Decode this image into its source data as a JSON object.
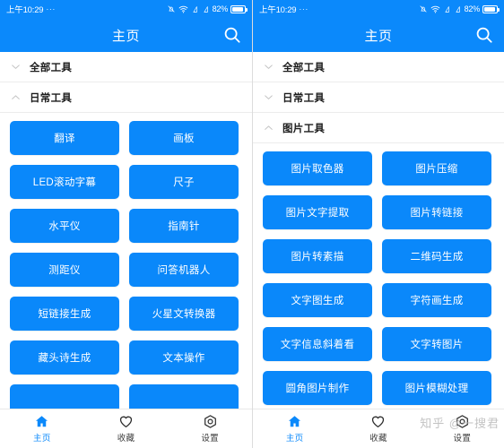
{
  "theme": {
    "primary": "#0b89fb",
    "button": "#0a88fa",
    "button_text": "#ffffff",
    "divider": "#ececec",
    "text": "#1b1b1b",
    "tab_inactive": "#3c3c3c",
    "watermark_color": "#b9b9b9"
  },
  "status_bar": {
    "time": "上午10:29",
    "dots": "···",
    "battery_percent": "82%",
    "icons": [
      "bell-muted-icon",
      "wifi-icon",
      "signal-icon",
      "signal-icon",
      "battery-icon"
    ]
  },
  "app_bar": {
    "title": "主页",
    "search_icon": "search-icon"
  },
  "panels": [
    {
      "id": "left",
      "sections": [
        {
          "label": "全部工具",
          "expanded": false,
          "chevron": "chevron-down-icon",
          "tools": []
        },
        {
          "label": "日常工具",
          "expanded": true,
          "chevron": "chevron-up-icon",
          "tools": [
            "翻译",
            "画板",
            "LED滚动字幕",
            "尺子",
            "水平仪",
            "指南针",
            "测距仪",
            "问答机器人",
            "短链接生成",
            "火星文转换器",
            "藏头诗生成",
            "文本操作",
            "",
            ""
          ]
        }
      ]
    },
    {
      "id": "right",
      "sections": [
        {
          "label": "全部工具",
          "expanded": false,
          "chevron": "chevron-down-icon",
          "tools": []
        },
        {
          "label": "日常工具",
          "expanded": false,
          "chevron": "chevron-down-icon",
          "tools": []
        },
        {
          "label": "图片工具",
          "expanded": true,
          "chevron": "chevron-up-icon",
          "tools": [
            "图片取色器",
            "图片压缩",
            "图片文字提取",
            "图片转链接",
            "图片转素描",
            "二维码生成",
            "文字图生成",
            "字符画生成",
            "文字信息斜着看",
            "文字转图片",
            "圆角图片制作",
            "图片模糊处理"
          ]
        }
      ]
    }
  ],
  "tab_bar": {
    "items": [
      {
        "label": "主页",
        "icon": "home-icon",
        "active": true
      },
      {
        "label": "收藏",
        "icon": "heart-icon",
        "active": false
      },
      {
        "label": "设置",
        "icon": "gear-icon",
        "active": false
      }
    ]
  },
  "watermark": {
    "text": "知乎 @一搜君"
  }
}
